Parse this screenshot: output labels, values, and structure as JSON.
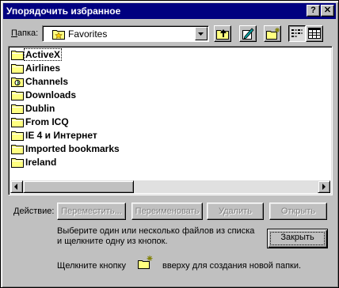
{
  "window": {
    "title": "Упорядочить избранное",
    "help_button": "?",
    "close_button": "✕"
  },
  "folder_bar": {
    "label": "Папка:",
    "current_folder": "Favorites",
    "folder_icon": "favorites-star-folder-icon",
    "tools": [
      "up-one-level-icon",
      "properties-icon",
      "new-folder-icon",
      "list-view-icon",
      "details-view-icon"
    ]
  },
  "file_list": {
    "items": [
      {
        "name": "ActiveX",
        "icon": "folder-icon",
        "selected": true
      },
      {
        "name": "Airlines",
        "icon": "folder-icon"
      },
      {
        "name": "Channels",
        "icon": "channels-folder-icon"
      },
      {
        "name": "Downloads",
        "icon": "folder-icon"
      },
      {
        "name": "Dublin",
        "icon": "folder-icon"
      },
      {
        "name": "From ICQ",
        "icon": "folder-icon"
      },
      {
        "name": "IE 4 и Интернет",
        "icon": "folder-icon"
      },
      {
        "name": "Imported bookmarks",
        "icon": "folder-icon"
      },
      {
        "name": "Ireland",
        "icon": "folder-icon"
      }
    ]
  },
  "actions": {
    "label": "Действие:",
    "move": "Переместить...",
    "rename": "Переименовать",
    "delete": "Удалить",
    "open": "Открыть"
  },
  "hint": {
    "line1": "Выберите один или несколько файлов из списка",
    "line2": "и щелкните одну из кнопок.",
    "new_folder_before": "Щелкните кнопку",
    "new_folder_after": "вверху для создания новой папки."
  },
  "close_label": "Закрыть",
  "colors": {
    "titlebar": "#000080",
    "face": "#c0c0c0",
    "folder": "#ffff80"
  }
}
